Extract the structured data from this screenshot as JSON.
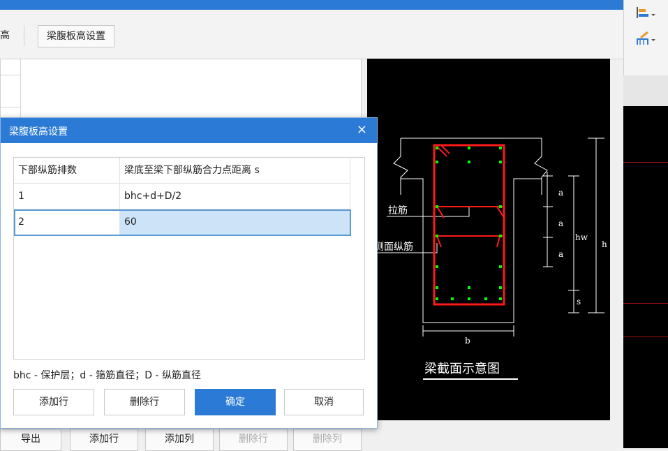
{
  "toolbar": {
    "partial_label": "高",
    "web_height_button": "梁腹板高设置"
  },
  "diagram": {
    "label_tie": "拉筋",
    "label_side_bar": "侧面纵筋",
    "label_a1": "a",
    "label_a2": "a",
    "label_a3": "a",
    "label_hw": "hw",
    "label_h": "h",
    "label_s": "s",
    "label_b": "b",
    "caption": "梁截面示意图"
  },
  "dialog": {
    "title": "梁腹板高设置",
    "close": "×",
    "columns": [
      "下部纵筋排数",
      "梁底至梁下部纵筋合力点距离 s"
    ],
    "rows": [
      [
        "1",
        "bhc+d+D/2"
      ],
      [
        "2",
        "60"
      ]
    ],
    "note": "bhc - 保护层；d - 箍筋直径；D - 纵筋直径",
    "buttons": {
      "add_row": "添加行",
      "delete_row": "删除行",
      "confirm": "确定",
      "cancel": "取消"
    }
  },
  "bottom_toolbar": {
    "export": "导出",
    "add_row": "添加行",
    "add_col": "添加列",
    "delete_row": "删除行",
    "delete_col": "删除列"
  },
  "colors": {
    "accent": "#2b7bd6",
    "rebar_red": "#ff1a1a",
    "rebar_dot_green": "#00ff00"
  }
}
